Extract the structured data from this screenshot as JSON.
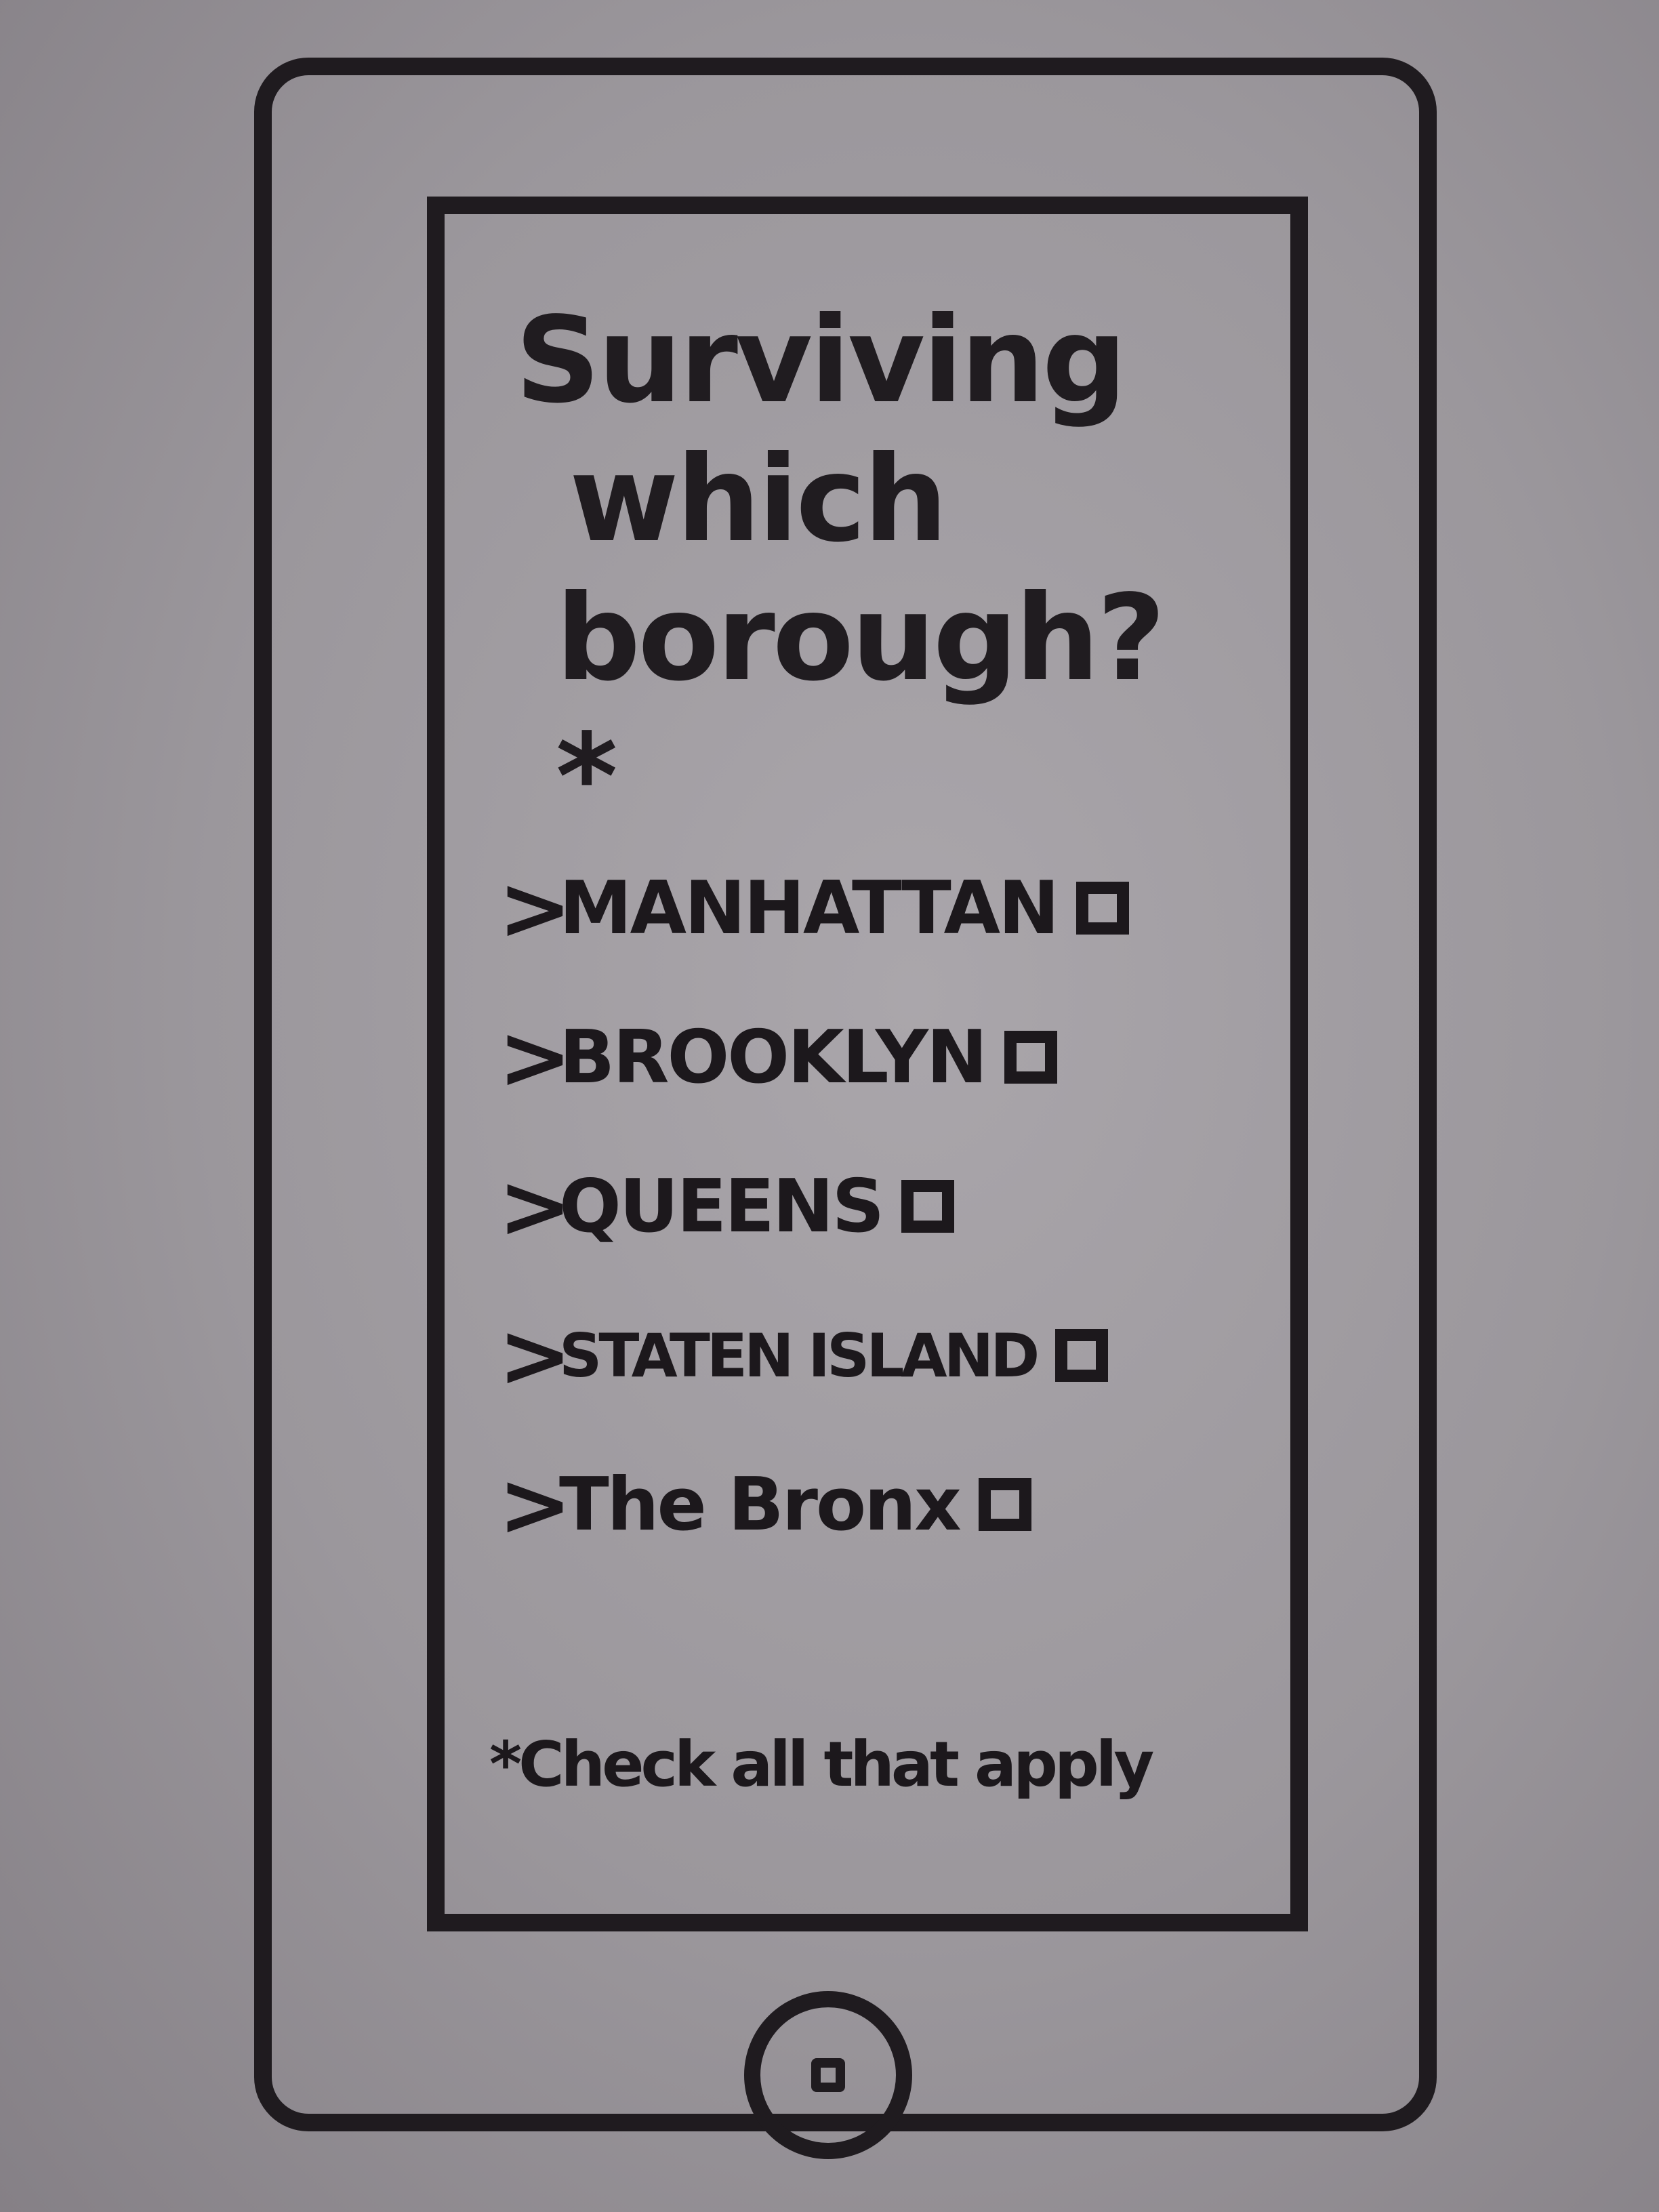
{
  "question": {
    "lines": [
      "Surviving",
      "which",
      "borough?*"
    ]
  },
  "options": [
    {
      "chevron": ">",
      "label": "MANHATTAN"
    },
    {
      "chevron": ">",
      "label": "BROOKLYN"
    },
    {
      "chevron": ">",
      "label": "QUEENS"
    },
    {
      "chevron": ">",
      "label": "STATEN ISLAND"
    },
    {
      "chevron": ">",
      "label": "The Bronx"
    }
  ],
  "footnote": "*Check all that apply",
  "icons": {
    "option_chevron": "chevron-right-icon",
    "checkbox": "checkbox-empty-icon",
    "home": "home-button-icon"
  },
  "colors": {
    "ink": "#1f1b1f",
    "paper": "#9e9a9e"
  }
}
